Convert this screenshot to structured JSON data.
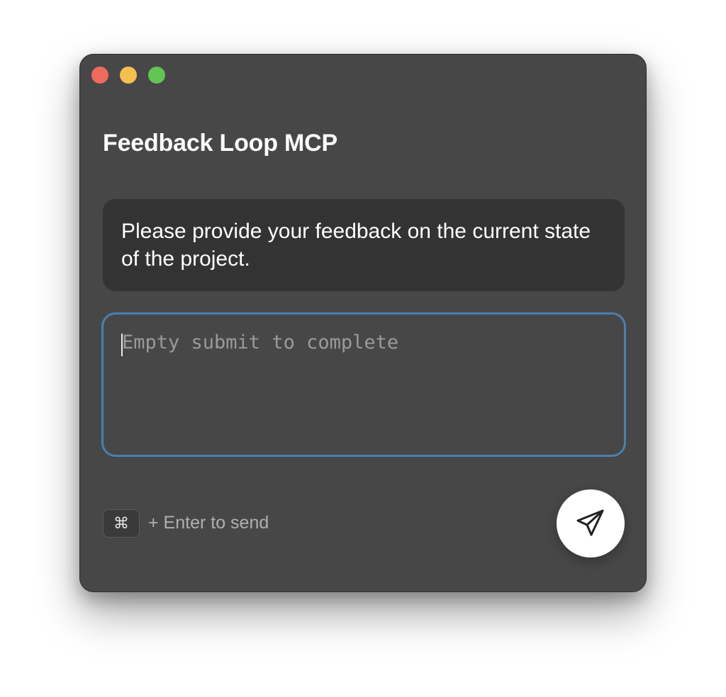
{
  "window": {
    "title": "Feedback Loop MCP"
  },
  "prompt": {
    "text": "Please provide your feedback on the current state of the project."
  },
  "feedback_input": {
    "value": "",
    "placeholder": "Empty submit to complete"
  },
  "shortcut": {
    "key": "⌘",
    "hint": "+ Enter to send"
  },
  "send_button": {
    "icon": "paper-plane-icon"
  },
  "colors": {
    "window_bg": "#474747",
    "prompt_bg": "#333333",
    "input_border": "#4a7fb0",
    "close": "#ed6a5e",
    "minimize": "#f5bf4f",
    "zoom": "#62c554"
  }
}
